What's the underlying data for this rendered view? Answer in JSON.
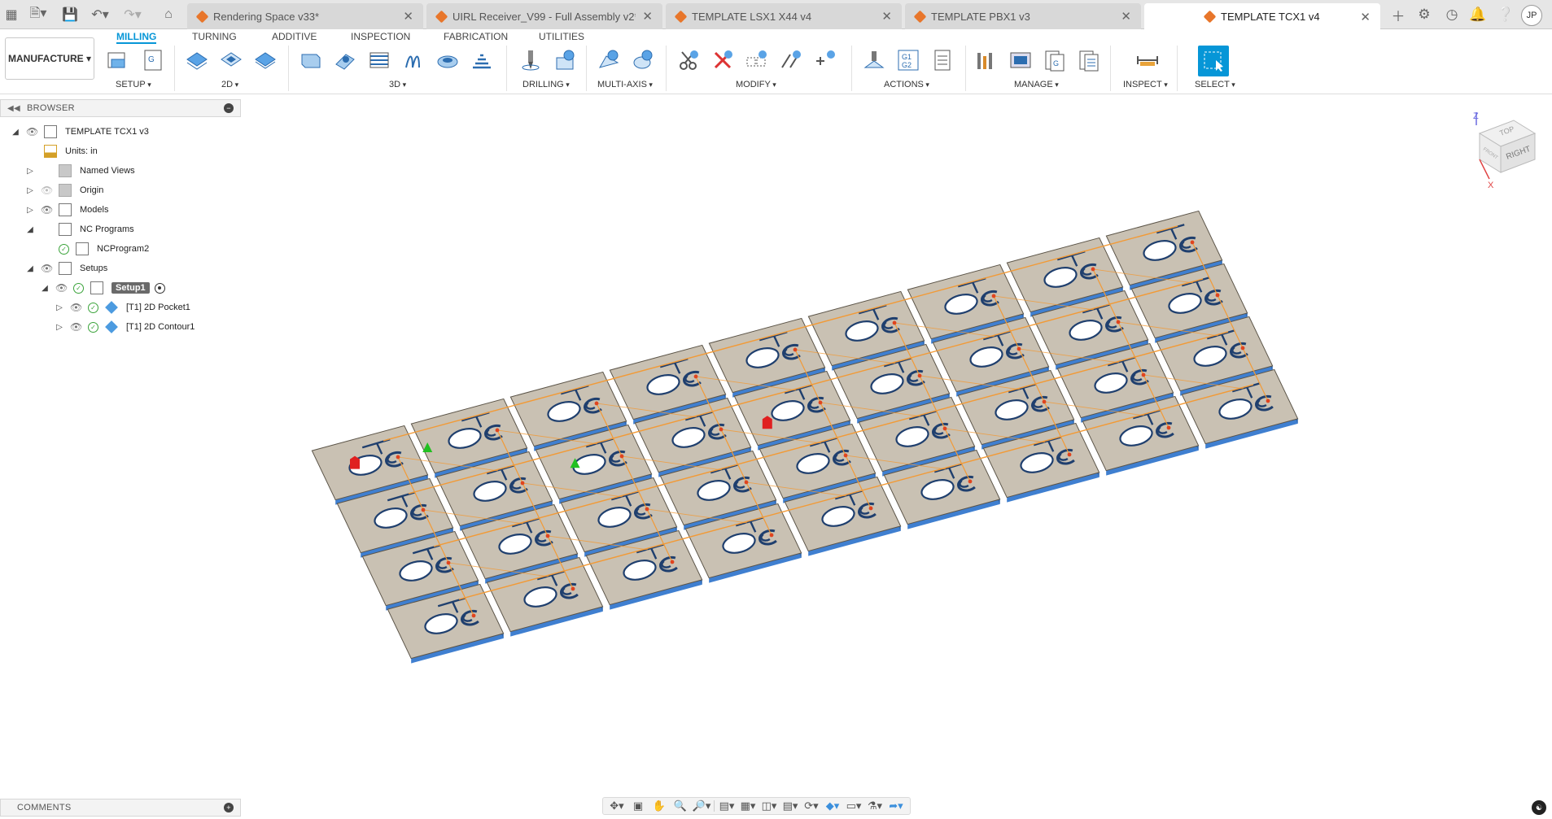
{
  "tabs": [
    {
      "label": "Rendering Space v33*",
      "active": false
    },
    {
      "label": "UIRL Receiver_V99 - Full Assembly v2*",
      "active": false
    },
    {
      "label": "TEMPLATE LSX1 X44 v4",
      "active": false
    },
    {
      "label": "TEMPLATE PBX1 v3",
      "active": false
    },
    {
      "label": "TEMPLATE TCX1 v4",
      "active": true
    }
  ],
  "user_initials": "JP",
  "workspace": "MANUFACTURE",
  "ribbon_tabs": [
    "MILLING",
    "TURNING",
    "ADDITIVE",
    "INSPECTION",
    "FABRICATION",
    "UTILITIES"
  ],
  "groups": [
    "SETUP",
    "2D",
    "3D",
    "DRILLING",
    "MULTI-AXIS",
    "MODIFY",
    "ACTIONS",
    "MANAGE",
    "INSPECT",
    "SELECT"
  ],
  "actions_g1g2": "G1\nG2",
  "browser": {
    "title": "BROWSER",
    "root": "TEMPLATE TCX1 v3",
    "units": "Units: in",
    "named_views": "Named Views",
    "origin": "Origin",
    "models": "Models",
    "nc_programs": "NC Programs",
    "nc_program": "NCProgram2",
    "setups": "Setups",
    "setup1": "Setup1",
    "op1": "[T1] 2D Pocket1",
    "op2": "[T1] 2D Contour1"
  },
  "comments": "COMMENTS",
  "viewcube": {
    "top": "TOP",
    "right": "RIGHT",
    "front": "FRONT",
    "axis_z": "Z",
    "axis_x": "X"
  },
  "colors": {
    "accent": "#0696d7",
    "part": "#c9c1b3",
    "part_edge": "#3f7fd0",
    "toolpath": "#f29a36"
  }
}
